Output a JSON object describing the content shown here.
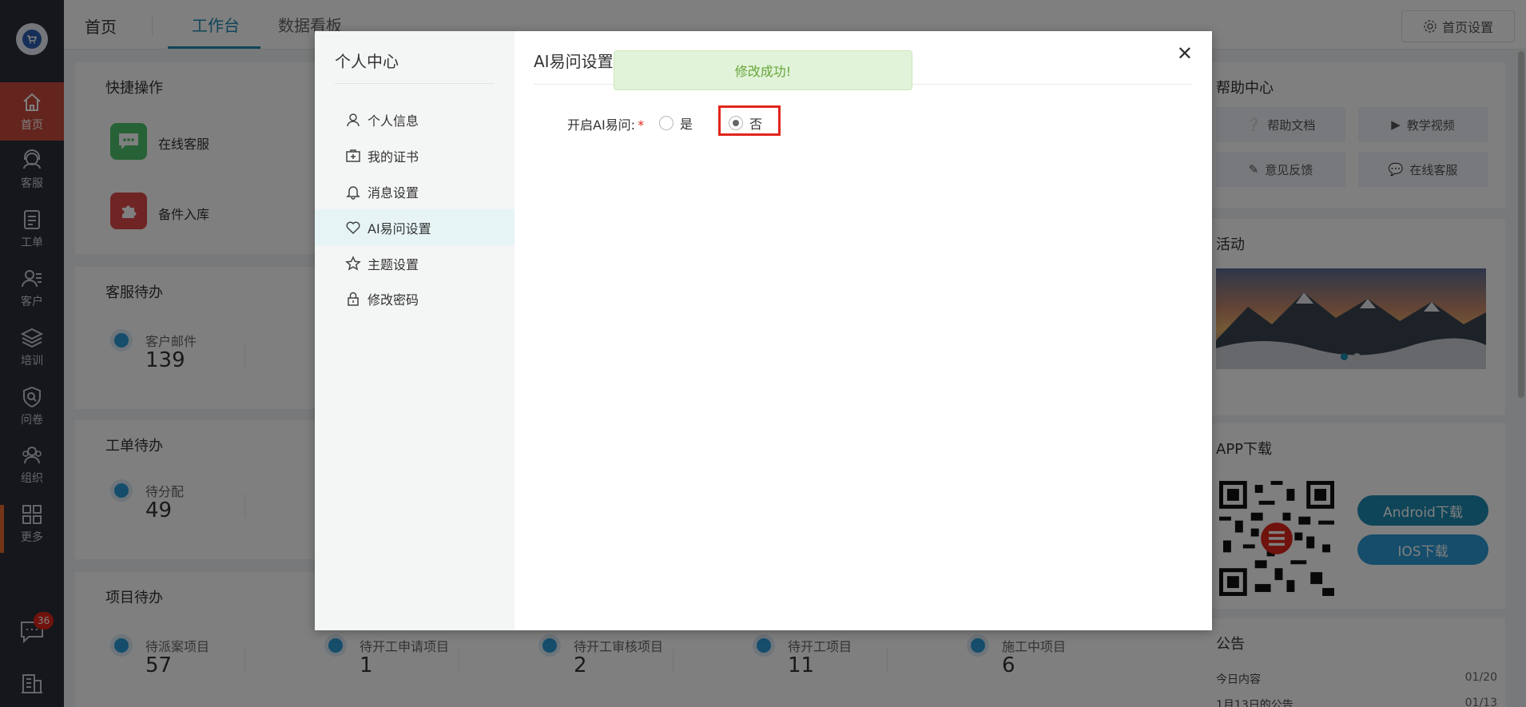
{
  "sidebar": {
    "badge_count": "36",
    "items": [
      {
        "label": "首页",
        "icon": "home-icon"
      },
      {
        "label": "客服",
        "icon": "headset-icon"
      },
      {
        "label": "工单",
        "icon": "clipboard-icon"
      },
      {
        "label": "客户",
        "icon": "customer-icon"
      },
      {
        "label": "培训",
        "icon": "layers-icon"
      },
      {
        "label": "问卷",
        "icon": "shield-search-icon"
      },
      {
        "label": "组织",
        "icon": "group-icon"
      },
      {
        "label": "更多",
        "icon": "grid-icon"
      }
    ]
  },
  "header": {
    "home": "首页",
    "tabs": [
      "工作台",
      "数据看板"
    ],
    "settings": "首页设置"
  },
  "quick_actions": {
    "title": "快捷操作",
    "items": [
      {
        "label": "在线客服",
        "icon": "chat-icon",
        "color": "#4cc46a"
      },
      {
        "label": "备件入库",
        "icon": "puzzle-icon",
        "color": "#e04a4a"
      }
    ]
  },
  "service_todo": {
    "title": "客服待办",
    "stats": [
      {
        "label": "客户邮件",
        "value": "139"
      }
    ]
  },
  "ticket_todo": {
    "title": "工单待办",
    "stats": [
      {
        "label": "待分配",
        "value": "49"
      }
    ]
  },
  "project_todo": {
    "title": "项目待办",
    "stats": [
      {
        "label": "待派案项目",
        "value": "57"
      },
      {
        "label": "待开工申请项目",
        "value": "1"
      },
      {
        "label": "待开工审核项目",
        "value": "2"
      },
      {
        "label": "待开工项目",
        "value": "11"
      },
      {
        "label": "施工中项目",
        "value": "6"
      }
    ]
  },
  "help_center": {
    "title": "帮助中心",
    "buttons": [
      {
        "label": "帮助文档",
        "icon": "question-icon"
      },
      {
        "label": "教学视频",
        "icon": "video-icon"
      },
      {
        "label": "意见反馈",
        "icon": "edit-icon"
      },
      {
        "label": "在线客服",
        "icon": "chat-icon"
      }
    ]
  },
  "activity": {
    "title": "活动"
  },
  "app_download": {
    "title": "APP下载",
    "android": "Android下载",
    "ios": "IOS下载"
  },
  "notice": {
    "title": "公告",
    "items": [
      {
        "text": "今日内容",
        "date": "01/20"
      },
      {
        "text": "1月13日的公告",
        "date": "01/13"
      }
    ]
  },
  "modal": {
    "side_title": "个人中心",
    "menu": [
      {
        "label": "个人信息",
        "icon": "user-icon"
      },
      {
        "label": "我的证书",
        "icon": "certificate-icon"
      },
      {
        "label": "消息设置",
        "icon": "bell-icon"
      },
      {
        "label": "AI易问设置",
        "icon": "heart-icon"
      },
      {
        "label": "主题设置",
        "icon": "star-icon"
      },
      {
        "label": "修改密码",
        "icon": "lock-icon"
      }
    ],
    "active_index": 3,
    "title": "AI易问设置",
    "toast": "修改成功!",
    "form": {
      "label": "开启AI易问:",
      "required": "*",
      "options": [
        "是",
        "否"
      ],
      "selected": "否"
    }
  },
  "colors": {
    "sidebar_bg": "#2b2f38",
    "sidebar_active": "#c94a3c",
    "accent": "#1f8ab0",
    "toast_bg": "#e1f3d8",
    "toast_text": "#67a53b",
    "highlight": "#e1251b"
  }
}
